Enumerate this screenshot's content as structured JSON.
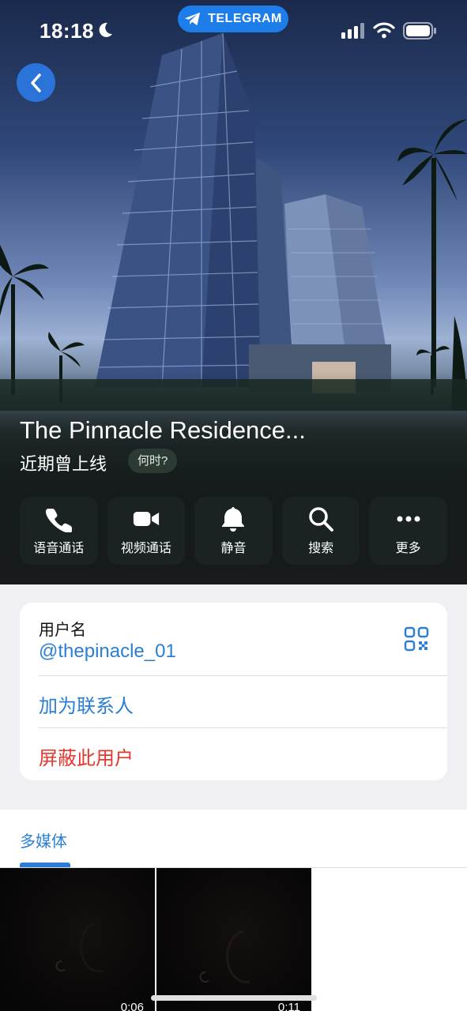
{
  "status_bar": {
    "time": "18:18",
    "app_pill": "TELEGRAM"
  },
  "profile": {
    "name": "The Pinnacle Residence...",
    "last_seen": "近期曾上线",
    "when_badge": "何时?"
  },
  "actions": [
    {
      "label": "语音通话",
      "icon": "phone-icon"
    },
    {
      "label": "视频通话",
      "icon": "video-icon"
    },
    {
      "label": "静音",
      "icon": "bell-icon"
    },
    {
      "label": "搜索",
      "icon": "search-icon"
    },
    {
      "label": "更多",
      "icon": "more-icon"
    }
  ],
  "info": {
    "username_label": "用户名",
    "username_value": "@thepinacle_01",
    "add_contact": "加为联系人",
    "block_user": "屏蔽此用户"
  },
  "media": {
    "tab_label": "多媒体",
    "items": [
      {
        "duration": "0:06"
      },
      {
        "duration": "0:11"
      }
    ]
  },
  "colors": {
    "accent": "#2a7fd5",
    "danger": "#e5372d",
    "pill": "#1d7ee9"
  }
}
